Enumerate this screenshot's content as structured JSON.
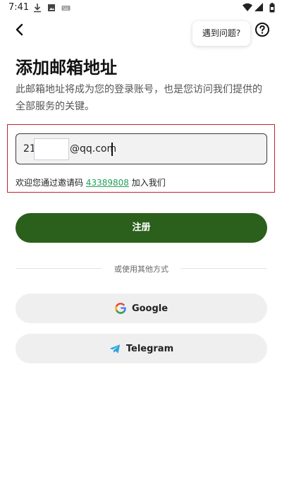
{
  "status_bar": {
    "time": "7:41"
  },
  "header": {
    "help_bubble": "遇到问题?"
  },
  "main": {
    "title": "添加邮箱地址",
    "description": "此邮箱地址将成为您的登录账号，也是您访问我们提供的全部服务的关键。",
    "email": {
      "visible_prefix": "21",
      "visible_suffix": "@qq.com"
    },
    "invite": {
      "prefix": "欢迎您通过邀请码 ",
      "code": "43389808",
      "suffix": " 加入我们"
    },
    "register_label": "注册",
    "divider_text": "或使用其他方式",
    "google_label": "Google",
    "telegram_label": "Telegram"
  },
  "colors": {
    "primary_button": "#2a5f1c",
    "invite_code": "#25a05a",
    "highlight_border": "#c0242c"
  },
  "icons": [
    "download-icon",
    "image-icon",
    "keyboard-icon",
    "wifi-icon",
    "signal-icon",
    "battery-icon",
    "back-arrow-icon",
    "help-circle-icon",
    "google-icon",
    "telegram-icon"
  ]
}
